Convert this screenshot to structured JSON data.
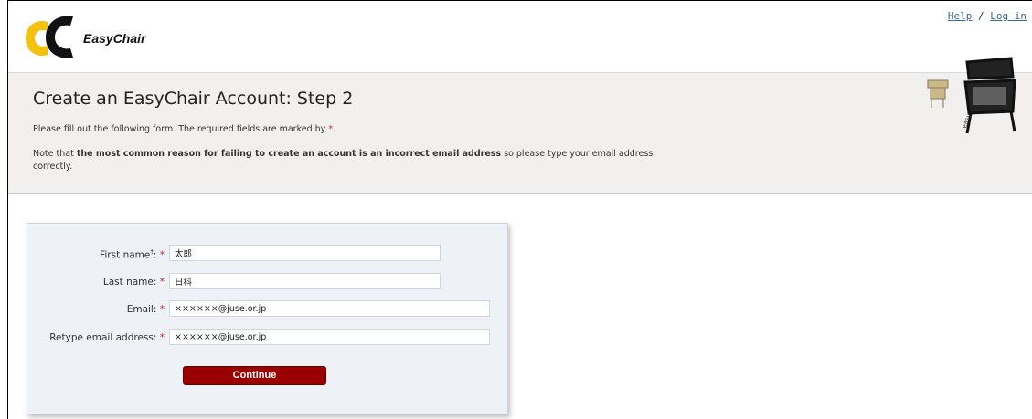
{
  "header": {
    "logo_text": "EasyChair",
    "help_link": "Help",
    "separator": "/",
    "login_link": "Log in"
  },
  "banner": {
    "title": "Create an EasyChair Account: Step 2",
    "instruction_prefix": "Please fill out the following form. The required fields are marked by",
    "required_marker": "*",
    "instruction_suffix": ".",
    "note_prefix": "Note that",
    "note_bold": "the most common reason for failing to create an account is an incorrect email address",
    "note_suffix": "so please type your email address correctly."
  },
  "form": {
    "fields": [
      {
        "label": "First name",
        "dagger": "†",
        "suffix": ":",
        "required": "*",
        "value": "太郎"
      },
      {
        "label": "Last name",
        "dagger": "",
        "suffix": ":",
        "required": "*",
        "value": "日科"
      },
      {
        "label": "Email",
        "dagger": "",
        "suffix": ":",
        "required": "*",
        "value": "××××××@juse.or.jp"
      },
      {
        "label": "Retype email address",
        "dagger": "",
        "suffix": ":",
        "required": "*",
        "value": "××××××@juse.or.jp"
      }
    ],
    "submit_label": "Continue"
  },
  "colors": {
    "accent_red": "#990000",
    "required_red": "#dd2222",
    "logo_yellow": "#f4c20d",
    "banner_bg": "#f1f0ef",
    "form_bg": "#eef1f6"
  }
}
